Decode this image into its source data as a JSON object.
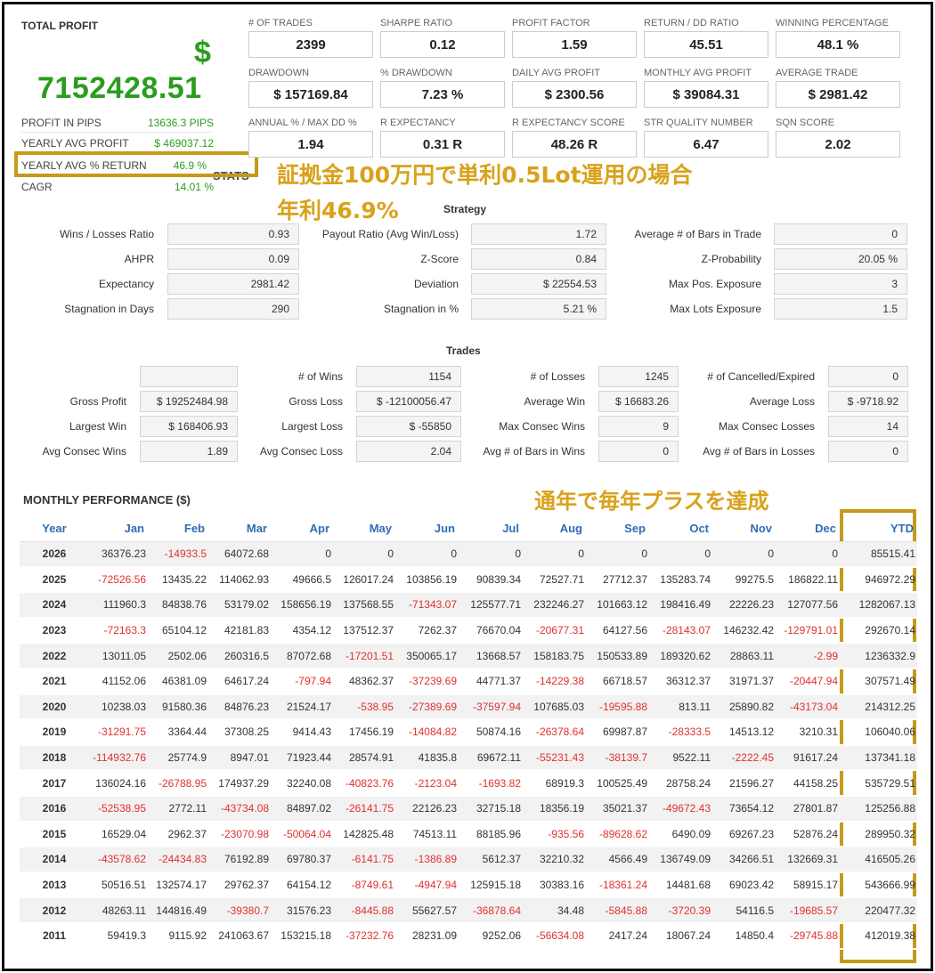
{
  "summary": {
    "title": "TOTAL PROFIT",
    "currency": "$",
    "total_profit": "7152428.51",
    "rows": [
      {
        "label": "PROFIT IN PIPS",
        "value": "13636.3 PIPS"
      },
      {
        "label": "YEARLY AVG PROFIT",
        "value": "$ 469037.12"
      },
      {
        "label": "YEARLY AVG % RETURN",
        "value": "46.9 %"
      },
      {
        "label": "CAGR",
        "value": "14.01 %"
      }
    ]
  },
  "metrics": [
    {
      "label": "# OF TRADES",
      "value": "2399"
    },
    {
      "label": "SHARPE RATIO",
      "value": "0.12"
    },
    {
      "label": "PROFIT FACTOR",
      "value": "1.59"
    },
    {
      "label": "RETURN / DD RATIO",
      "value": "45.51"
    },
    {
      "label": "WINNING PERCENTAGE",
      "value": "48.1 %"
    },
    {
      "label": "DRAWDOWN",
      "value": "$ 157169.84"
    },
    {
      "label": "% DRAWDOWN",
      "value": "7.23 %"
    },
    {
      "label": "DAILY AVG PROFIT",
      "value": "$ 2300.56"
    },
    {
      "label": "MONTHLY AVG PROFIT",
      "value": "$ 39084.31"
    },
    {
      "label": "AVERAGE TRADE",
      "value": "$ 2981.42"
    },
    {
      "label": "ANNUAL % / MAX DD %",
      "value": "1.94"
    },
    {
      "label": "R EXPECTANCY",
      "value": "0.31 R"
    },
    {
      "label": "R EXPECTANCY SCORE",
      "value": "48.26 R"
    },
    {
      "label": "STR QUALITY NUMBER",
      "value": "6.47"
    },
    {
      "label": "SQN SCORE",
      "value": "2.02"
    }
  ],
  "annotations": {
    "line1": "証拠金100万円で単利0.5Lot運用の場合",
    "line2": "年利46.9%",
    "monthly": "通年で毎年プラスを達成",
    "stats_clip": "STATS",
    "accent": "#d9a21b"
  },
  "strategy": {
    "title": "Strategy",
    "rows": [
      [
        {
          "label": "Wins / Losses Ratio",
          "value": "0.93"
        },
        {
          "label": "Payout Ratio (Avg Win/Loss)",
          "value": "1.72"
        },
        {
          "label": "Average # of Bars in Trade",
          "value": "0"
        }
      ],
      [
        {
          "label": "AHPR",
          "value": "0.09"
        },
        {
          "label": "Z-Score",
          "value": "0.84"
        },
        {
          "label": "Z-Probability",
          "value": "20.05 %"
        }
      ],
      [
        {
          "label": "Expectancy",
          "value": "2981.42"
        },
        {
          "label": "Deviation",
          "value": "$ 22554.53"
        },
        {
          "label": "Max Pos. Exposure",
          "value": "3"
        }
      ],
      [
        {
          "label": "Stagnation in Days",
          "value": "290"
        },
        {
          "label": "Stagnation in %",
          "value": "5.21 %"
        },
        {
          "label": "Max Lots Exposure",
          "value": "1.5"
        }
      ]
    ]
  },
  "trades": {
    "title": "Trades",
    "rows": [
      [
        {
          "label": "",
          "value": ""
        },
        {
          "label": "# of Wins",
          "value": "1154"
        },
        {
          "label": "# of Losses",
          "value": "1245"
        },
        {
          "label": "# of Cancelled/Expired",
          "value": "0"
        }
      ],
      [
        {
          "label": "Gross Profit",
          "value": "$ 19252484.98"
        },
        {
          "label": "Gross Loss",
          "value": "$ -12100056.47"
        },
        {
          "label": "Average Win",
          "value": "$ 16683.26"
        },
        {
          "label": "Average Loss",
          "value": "$ -9718.92"
        }
      ],
      [
        {
          "label": "Largest Win",
          "value": "$ 168406.93"
        },
        {
          "label": "Largest Loss",
          "value": "$ -55850"
        },
        {
          "label": "Max Consec Wins",
          "value": "9"
        },
        {
          "label": "Max Consec Losses",
          "value": "14"
        }
      ],
      [
        {
          "label": "Avg Consec Wins",
          "value": "1.89"
        },
        {
          "label": "Avg Consec Loss",
          "value": "2.04"
        },
        {
          "label": "Avg # of Bars in Wins",
          "value": "0"
        },
        {
          "label": "Avg # of Bars in Losses",
          "value": "0"
        }
      ]
    ]
  },
  "monthly": {
    "title": "MONTHLY PERFORMANCE ($)",
    "headers": [
      "Year",
      "Jan",
      "Feb",
      "Mar",
      "Apr",
      "May",
      "Jun",
      "Jul",
      "Aug",
      "Sep",
      "Oct",
      "Nov",
      "Dec",
      "YTD"
    ],
    "rows": [
      [
        "2026",
        "36376.23",
        "-14933.5",
        "64072.68",
        "0",
        "0",
        "0",
        "0",
        "0",
        "0",
        "0",
        "0",
        "0",
        "85515.41"
      ],
      [
        "2025",
        "-72526.56",
        "13435.22",
        "114062.93",
        "49666.5",
        "126017.24",
        "103856.19",
        "90839.34",
        "72527.71",
        "27712.37",
        "135283.74",
        "99275.5",
        "186822.11",
        "946972.29"
      ],
      [
        "2024",
        "111960.3",
        "84838.76",
        "53179.02",
        "158656.19",
        "137568.55",
        "-71343.07",
        "125577.71",
        "232246.27",
        "101663.12",
        "198416.49",
        "22226.23",
        "127077.56",
        "1282067.13"
      ],
      [
        "2023",
        "-72163.3",
        "65104.12",
        "42181.83",
        "4354.12",
        "137512.37",
        "7262.37",
        "76670.04",
        "-20677.31",
        "64127.56",
        "-28143.07",
        "146232.42",
        "-129791.01",
        "292670.14"
      ],
      [
        "2022",
        "13011.05",
        "2502.06",
        "260316.5",
        "87072.68",
        "-17201.51",
        "350065.17",
        "13668.57",
        "158183.75",
        "150533.89",
        "189320.62",
        "28863.11",
        "-2.99",
        "1236332.9"
      ],
      [
        "2021",
        "41152.06",
        "46381.09",
        "64617.24",
        "-797.94",
        "48362.37",
        "-37239.69",
        "44771.37",
        "-14229.38",
        "66718.57",
        "36312.37",
        "31971.37",
        "-20447.94",
        "307571.49"
      ],
      [
        "2020",
        "10238.03",
        "91580.36",
        "84876.23",
        "21524.17",
        "-538.95",
        "-27389.69",
        "-37597.94",
        "107685.03",
        "-19595.88",
        "813.11",
        "25890.82",
        "-43173.04",
        "214312.25"
      ],
      [
        "2019",
        "-31291.75",
        "3364.44",
        "37308.25",
        "9414.43",
        "17456.19",
        "-14084.82",
        "50874.16",
        "-26378.64",
        "69987.87",
        "-28333.5",
        "14513.12",
        "3210.31",
        "106040.06"
      ],
      [
        "2018",
        "-114932.76",
        "25774.9",
        "8947.01",
        "71923.44",
        "28574.91",
        "41835.8",
        "69672.11",
        "-55231.43",
        "-38139.7",
        "9522.11",
        "-2222.45",
        "91617.24",
        "137341.18"
      ],
      [
        "2017",
        "136024.16",
        "-26788.95",
        "174937.29",
        "32240.08",
        "-40823.76",
        "-2123.04",
        "-1693.82",
        "68919.3",
        "100525.49",
        "28758.24",
        "21596.27",
        "44158.25",
        "535729.51"
      ],
      [
        "2016",
        "-52538.95",
        "2772.11",
        "-43734.08",
        "84897.02",
        "-26141.75",
        "22126.23",
        "32715.18",
        "18356.19",
        "35021.37",
        "-49672.43",
        "73654.12",
        "27801.87",
        "125256.88"
      ],
      [
        "2015",
        "16529.04",
        "2962.37",
        "-23070.98",
        "-50064.04",
        "142825.48",
        "74513.11",
        "88185.96",
        "-935.56",
        "-89628.62",
        "6490.09",
        "69267.23",
        "52876.24",
        "289950.32"
      ],
      [
        "2014",
        "-43578.62",
        "-24434.83",
        "76192.89",
        "69780.37",
        "-6141.75",
        "-1386.89",
        "5612.37",
        "32210.32",
        "4566.49",
        "136749.09",
        "34266.51",
        "132669.31",
        "416505.26"
      ],
      [
        "2013",
        "50516.51",
        "132574.17",
        "29762.37",
        "64154.12",
        "-8749.61",
        "-4947.94",
        "125915.18",
        "30383.16",
        "-18361.24",
        "14481.68",
        "69023.42",
        "58915.17",
        "543666.99"
      ],
      [
        "2012",
        "48263.11",
        "144816.49",
        "-39380.7",
        "31576.23",
        "-8445.88",
        "55627.57",
        "-36878.64",
        "34.48",
        "-5845.88",
        "-3720.39",
        "54116.5",
        "-19685.57",
        "220477.32"
      ],
      [
        "2011",
        "59419.3",
        "9115.92",
        "241063.67",
        "153215.18",
        "-37232.76",
        "28231.09",
        "9252.06",
        "-56634.08",
        "2417.24",
        "18067.24",
        "14850.4",
        "-29745.88",
        "412019.38"
      ]
    ]
  }
}
